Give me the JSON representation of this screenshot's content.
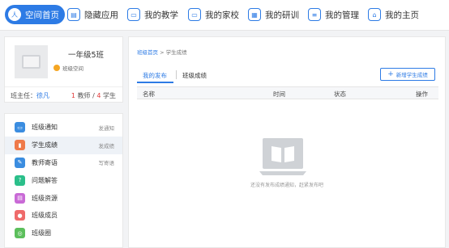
{
  "nav": {
    "items": [
      {
        "label": "空间首页",
        "icon": "user-icon",
        "glyph": "人",
        "active": true
      },
      {
        "label": "隐藏应用",
        "icon": "apps-icon",
        "glyph": "▤",
        "active": false
      },
      {
        "label": "我的教学",
        "icon": "teaching-icon",
        "glyph": "▭",
        "active": false
      },
      {
        "label": "我的家校",
        "icon": "monitor-icon",
        "glyph": "▭",
        "active": false
      },
      {
        "label": "我的研训",
        "icon": "grid-icon",
        "glyph": "▦",
        "active": false
      },
      {
        "label": "我的管理",
        "icon": "document-icon",
        "glyph": "≡",
        "active": false
      },
      {
        "label": "我的主页",
        "icon": "home-icon",
        "glyph": "⌂",
        "active": false
      }
    ]
  },
  "class_card": {
    "name": "一年级5班",
    "space_link": "班级空间",
    "teacher_label": "班主任：",
    "teacher_name": "徐凡",
    "teacher_count": "1",
    "teacher_unit": "教师",
    "separator": "/",
    "student_count": "4",
    "student_unit": "学生"
  },
  "menu": {
    "items": [
      {
        "label": "班级通知",
        "right": "发通知",
        "icon": "notice-icon",
        "color": "#3b8de0",
        "glyph": "▭",
        "selected": false
      },
      {
        "label": "学生成绩",
        "right": "发成绩",
        "icon": "chart-icon",
        "color": "#ef7a4a",
        "glyph": "▮",
        "selected": true
      },
      {
        "label": "教师寄语",
        "right": "写寄语",
        "icon": "message-icon",
        "color": "#3b8de0",
        "glyph": "✎",
        "selected": false
      },
      {
        "label": "问题解答",
        "right": "",
        "icon": "question-icon",
        "color": "#2bbf8a",
        "glyph": "?",
        "selected": false
      },
      {
        "label": "班级资源",
        "right": "",
        "icon": "resource-icon",
        "color": "#c96ad6",
        "glyph": "▤",
        "selected": false
      },
      {
        "label": "班级成员",
        "right": "",
        "icon": "members-icon",
        "color": "#ef6b6b",
        "glyph": "●",
        "selected": false
      },
      {
        "label": "班级圈",
        "right": "",
        "icon": "circle-icon",
        "color": "#5cbf5c",
        "glyph": "◎",
        "selected": false
      }
    ]
  },
  "main": {
    "breadcrumb_home": "班级首页",
    "breadcrumb_sep": ">",
    "breadcrumb_current": "学生成绩",
    "tab_mine": "我的发布",
    "tab_scores": "班级成绩",
    "add_button": "新增学生成绩",
    "columns": {
      "name": "名称",
      "time": "时间",
      "status": "状态",
      "op": "操作"
    },
    "empty_text": "还没有发布成绩通知，赶紧发布吧"
  },
  "colors": {
    "accent": "#2d7be5",
    "count_red": "#e23a3a"
  }
}
